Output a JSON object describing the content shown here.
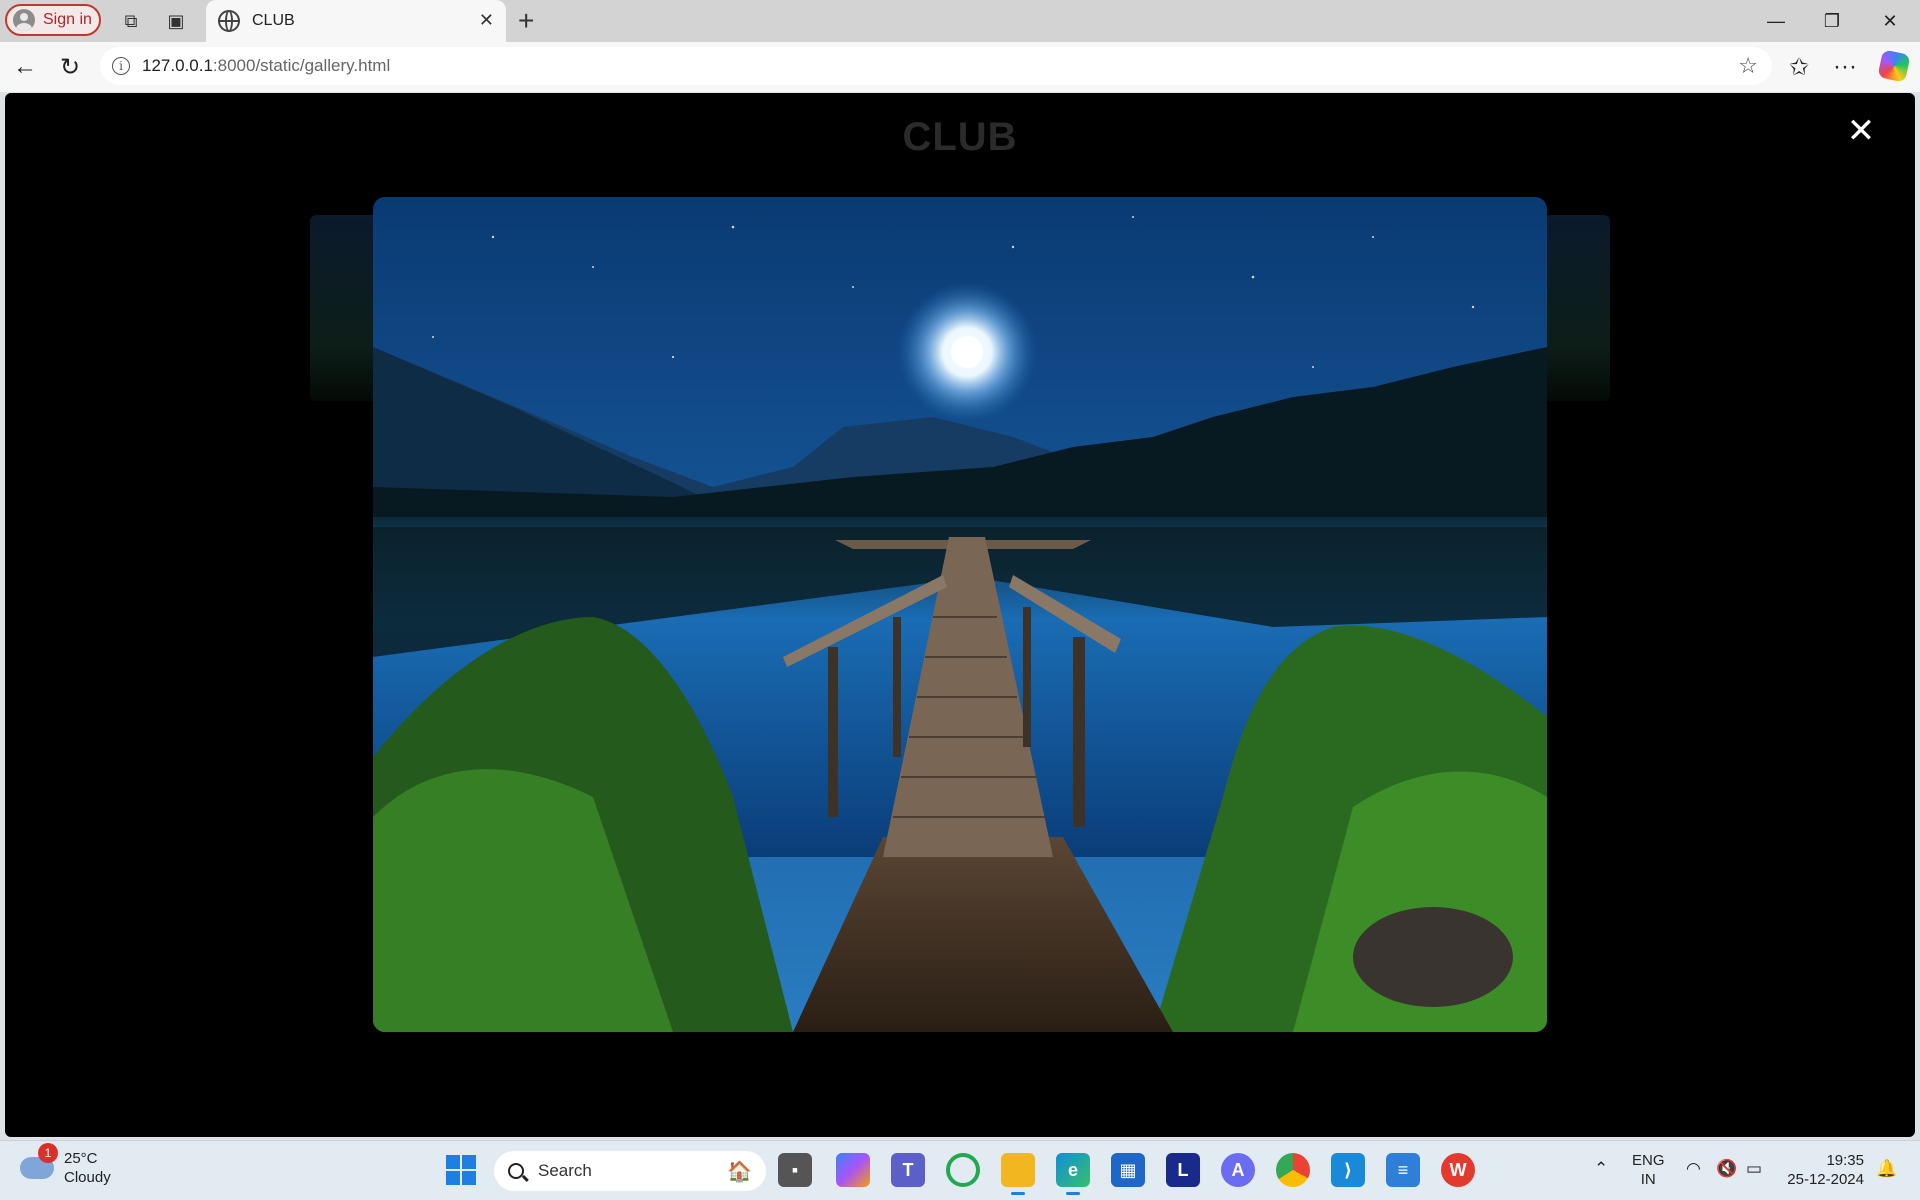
{
  "browser": {
    "signin_label": "Sign in",
    "tab_title": "CLUB",
    "url_host": "127.0.0.1",
    "url_rest": ":8000/static/gallery.html"
  },
  "page": {
    "title": "CLUB",
    "close_symbol": "✕"
  },
  "taskbar": {
    "weather_temp": "25°C",
    "weather_desc": "Cloudy",
    "weather_badge": "1",
    "search_label": "Search",
    "lang_top": "ENG",
    "lang_bottom": "IN",
    "time": "19:35",
    "date": "25-12-2024",
    "apps": [
      "task-view",
      "copilot",
      "teams",
      "circle-app",
      "file-explorer",
      "edge",
      "store",
      "l-app",
      "arc-app",
      "chrome",
      "vscode",
      "notepad",
      "wps"
    ]
  },
  "colors": {
    "accent": "#1e7fe0",
    "signin_border": "#c0392b",
    "page_bg": "#000000"
  }
}
